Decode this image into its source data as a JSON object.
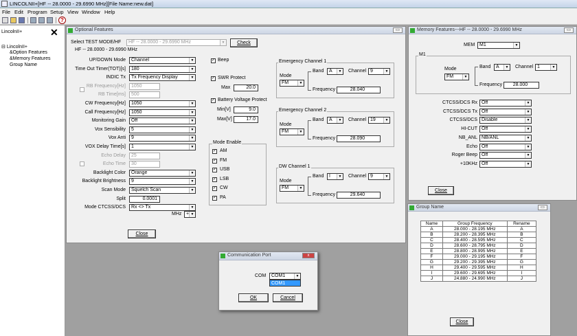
{
  "app": {
    "title": "LINCOLNII+[HF -- 28.0000 - 29.6990 MHz][File Name:new.dat]",
    "menu": [
      "File",
      "Edit",
      "Program",
      "Setup",
      "View",
      "Window",
      "Help"
    ]
  },
  "tree": {
    "header": "LincolnII+",
    "root": "LincolnII+",
    "items": [
      "&Option Features",
      "&Memory Features",
      "Group Name"
    ]
  },
  "optional": {
    "title": "Optional Features",
    "select_label": "Select TEST MODE/HF",
    "select_value": "HF -- 28.0000 - 29.6990 MHz",
    "check": "Check",
    "band_label": "HF -- 28.0000 - 29.6990 MHz",
    "fields": [
      {
        "label": "UP/DOWN Mode",
        "value": "Channel"
      },
      {
        "label": "Time Out Timer(TOT)[s]",
        "value": "180"
      },
      {
        "label": "INDIC Tx",
        "value": "Tx Frequency Display"
      },
      {
        "label": "RB Frequency[Hz]",
        "value": "1050"
      },
      {
        "label": "RB Time[ms]",
        "value": "500"
      },
      {
        "label": "CW Frequency[Hz]",
        "value": "1050"
      },
      {
        "label": "Call Frequency[Hz]",
        "value": "1050"
      },
      {
        "label": "Monitoring Gain",
        "value": "Off"
      },
      {
        "label": "Vox Sensibility",
        "value": "5"
      },
      {
        "label": "Vox Anti",
        "value": "9"
      },
      {
        "label": "VOX Delay Time[s]",
        "value": "1"
      },
      {
        "label": "Echo Delay",
        "value": "25"
      },
      {
        "label": "Echo Time",
        "value": "30"
      },
      {
        "label": "Backlight Color",
        "value": "Orange"
      },
      {
        "label": "Backlight Brightness",
        "value": "9"
      },
      {
        "label": "Scan Mode",
        "value": "Squelch Scan"
      },
      {
        "label": "Split",
        "value": "0.0001"
      },
      {
        "label": "Mode CTCSS/DCS",
        "value": "Rx <> Tx"
      }
    ],
    "split_unit": "MHz",
    "split_sign": "+",
    "beep": "Beep",
    "swr": "SWR Protect",
    "swr_max_label": "Max",
    "swr_max": "20.0",
    "bat": "Battery Voltage Protect",
    "bat_min_label": "Min[V]",
    "bat_min": "9.0",
    "bat_max_label": "Max[V]",
    "bat_max": "17.0",
    "mode_enable": "Mode Enable",
    "modes": [
      "AM",
      "FM",
      "USB",
      "LSB",
      "CW",
      "PA"
    ],
    "emergency": [
      {
        "title": "Emergency Channel 1",
        "mode": "FM",
        "band": "A",
        "channel": "9",
        "freq": "28.040"
      },
      {
        "title": "Emergency Channel 2",
        "mode": "FM",
        "band": "A",
        "channel": "19",
        "freq": "28.090"
      },
      {
        "title": "DW Channel 1",
        "mode": "FM",
        "band": "I",
        "channel": "9",
        "freq": "29.640"
      }
    ],
    "mode_label": "Mode",
    "band_lbl": "Band",
    "channel_lbl": "Channel",
    "freq_lbl": "Frequency",
    "close": "Close"
  },
  "memory": {
    "title": "Memory Features---HF -- 28.0000 - 29.6990 MHz",
    "mem_label": "MEM",
    "mem_value": "M1",
    "group": "M1",
    "mode_label": "Mode",
    "mode": "FM",
    "band_label": "Band",
    "band": "A",
    "channel_label": "Channel",
    "channel": "1",
    "freq_label": "Frequency",
    "freq": "28.000",
    "rows": [
      {
        "label": "CTCSS/DCS Rx",
        "value": "Off"
      },
      {
        "label": "CTCSS/DCS Tx",
        "value": "Off"
      },
      {
        "label": "CTCSS/DCS",
        "value": "Disable"
      },
      {
        "label": "HI-CUT",
        "value": "Off"
      },
      {
        "label": "NB_ANL",
        "value": "NB/ANL"
      },
      {
        "label": "Echo",
        "value": "Off"
      },
      {
        "label": "Roger Beep",
        "value": "Off"
      },
      {
        "label": "+10KHz",
        "value": "Off"
      }
    ],
    "close": "Close"
  },
  "group": {
    "title": "Group Name",
    "headers": [
      "Name",
      "Group Frequency",
      "Rename"
    ],
    "rows": [
      [
        "A",
        "28.000 - 28.195 MHz",
        "A"
      ],
      [
        "B",
        "28.200 - 28.395 MHz",
        "B"
      ],
      [
        "C",
        "28.400 - 28.595 MHz",
        "C"
      ],
      [
        "D",
        "28.600 - 28.795 MHz",
        "D"
      ],
      [
        "E",
        "28.800 - 28.995 MHz",
        "E"
      ],
      [
        "F",
        "29.000 - 29.195 MHz",
        "F"
      ],
      [
        "G",
        "29.200 - 29.395 MHz",
        "G"
      ],
      [
        "H",
        "29.400 - 29.595 MHz",
        "H"
      ],
      [
        "I",
        "29.600 - 29.695 MHz",
        "I"
      ],
      [
        "J",
        "24.880 - 24.990 MHz",
        "J"
      ]
    ],
    "close": "Close"
  },
  "comm": {
    "title": "Communication Port",
    "com_label": "COM",
    "com_value": "COM1",
    "option": "COM1",
    "ok": "OK",
    "cancel": "Cancel"
  }
}
